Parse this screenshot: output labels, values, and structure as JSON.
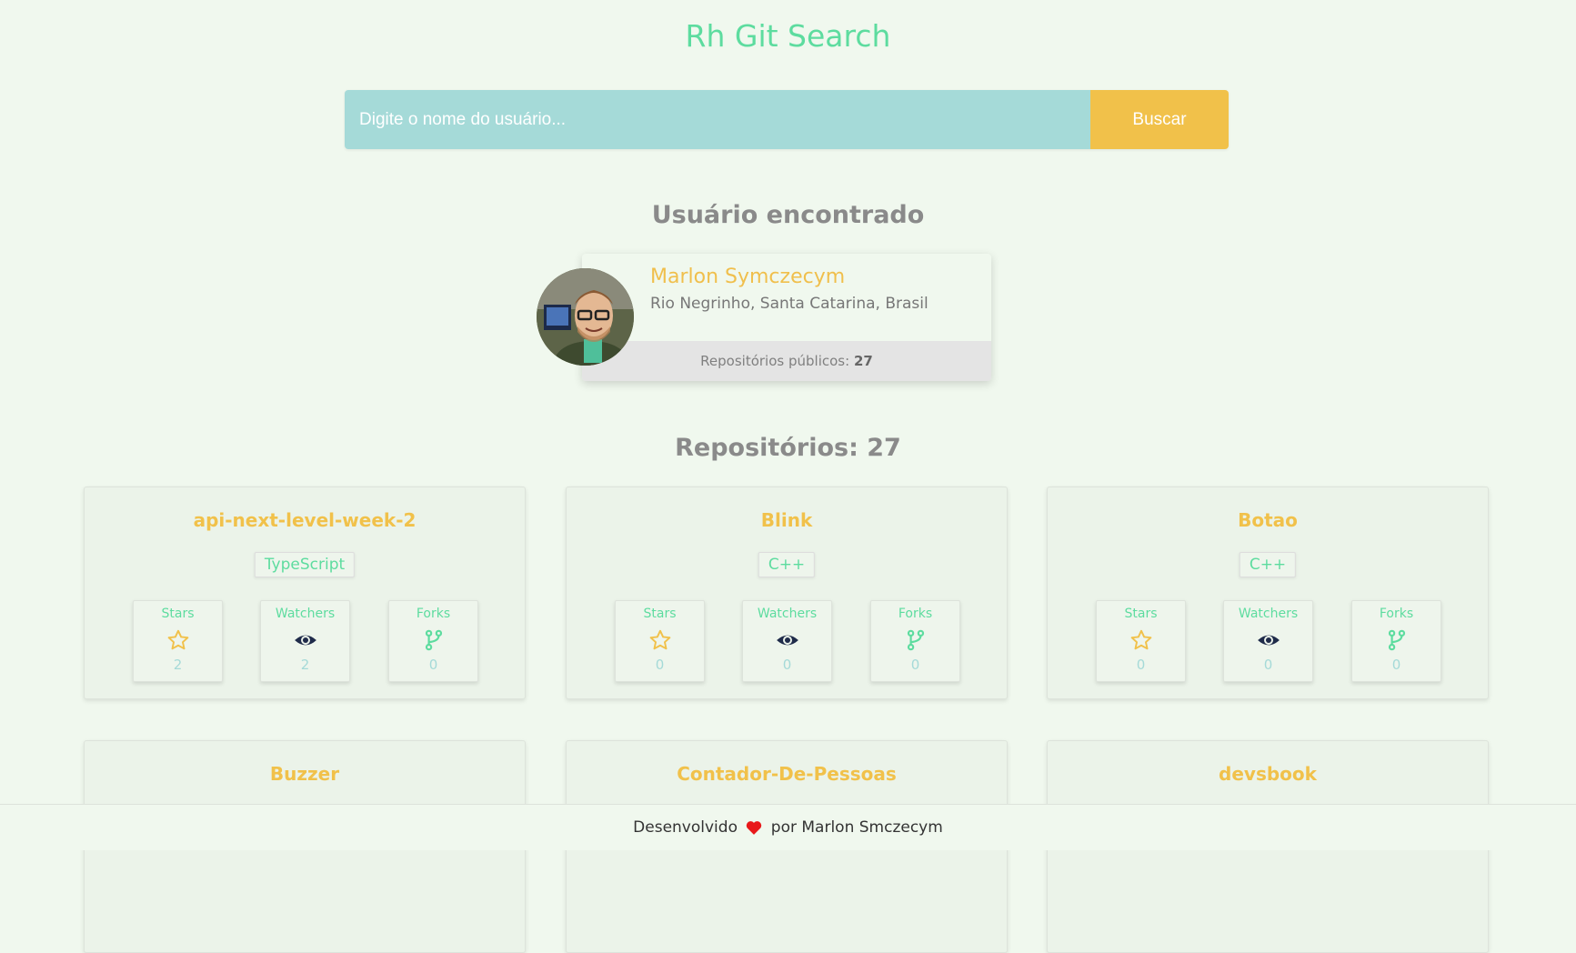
{
  "app": {
    "title": "Rh Git Search"
  },
  "search": {
    "placeholder": "Digite o nome do usuário...",
    "button_label": "Buscar"
  },
  "user_section": {
    "heading": "Usuário encontrado"
  },
  "user": {
    "name": "Marlon Symczecym",
    "location": "Rio Negrinho, Santa Catarina, Brasil",
    "public_repos_label": "Repositórios públicos:",
    "public_repos_count": "27"
  },
  "repos_section": {
    "heading": "Repositórios: 27"
  },
  "stat_labels": {
    "stars": "Stars",
    "watchers": "Watchers",
    "forks": "Forks"
  },
  "repos": [
    {
      "name": "api-next-level-week-2",
      "language": "TypeScript",
      "stars": "2",
      "watchers": "2",
      "forks": "0"
    },
    {
      "name": "Blink",
      "language": "C++",
      "stars": "0",
      "watchers": "0",
      "forks": "0"
    },
    {
      "name": "Botao",
      "language": "C++",
      "stars": "0",
      "watchers": "0",
      "forks": "0"
    },
    {
      "name": "Buzzer"
    },
    {
      "name": "Contador-De-Pessoas"
    },
    {
      "name": "devsbook"
    }
  ],
  "footer": {
    "text_before": "Desenvolvido",
    "text_after": "por Marlon Smczecym"
  },
  "colors": {
    "background": "#f0f8ee",
    "accent_green": "#5ddc9f",
    "accent_yellow": "#f1c14a",
    "input_teal": "#a5dad8",
    "heading_gray": "#8a8a8a",
    "heart_red": "#e8191a"
  },
  "icons": {
    "stars": "star-icon",
    "watchers": "eye-icon",
    "forks": "fork-icon",
    "footer": "heart-icon"
  }
}
